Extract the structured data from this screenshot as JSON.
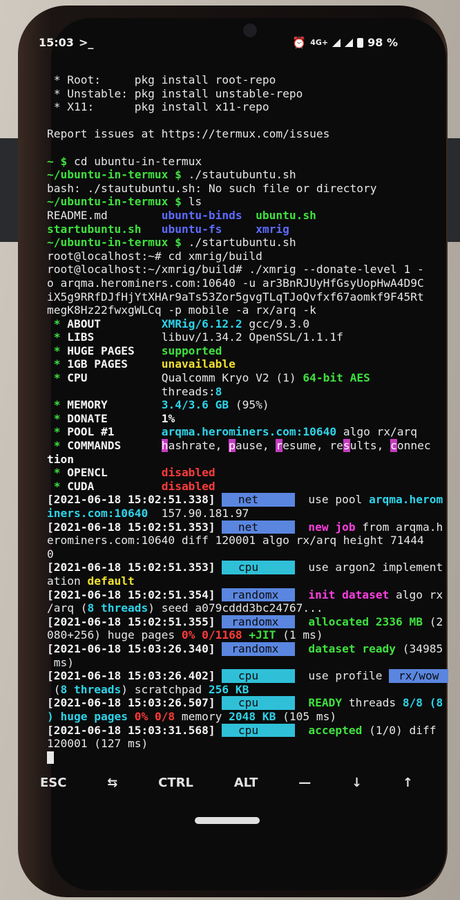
{
  "status_bar": {
    "time": "15:03",
    "prompt_icon": ">_",
    "network": "4G+",
    "battery": "98 %",
    "icons": [
      "alarm-icon",
      "signal-icon",
      "signal-icon",
      "battery-icon"
    ]
  },
  "terminal_lines": [
    [
      {
        "t": " * Root:     pkg install root-repo"
      }
    ],
    [
      {
        "t": " * Unstable: pkg install unstable-repo"
      }
    ],
    [
      {
        "t": " * X11:      pkg install x11-repo"
      }
    ],
    [
      {
        "t": ""
      }
    ],
    [
      {
        "t": "Report issues at https://termux.com/issues"
      }
    ],
    [
      {
        "t": ""
      }
    ],
    [
      {
        "t": "~ $ ",
        "c": "g"
      },
      {
        "t": "cd ubuntu-in-termux"
      }
    ],
    [
      {
        "t": "~/ubuntu-in-termux $ ",
        "c": "g"
      },
      {
        "t": "./stautubuntu.sh"
      }
    ],
    [
      {
        "t": "bash: ./stautubuntu.sh: No such file or directory"
      }
    ],
    [
      {
        "t": "~/ubuntu-in-termux $ ",
        "c": "g"
      },
      {
        "t": "ls"
      }
    ],
    [
      {
        "t": "README.md        "
      },
      {
        "t": "ubuntu-binds",
        "c": "b"
      },
      {
        "t": "  "
      },
      {
        "t": "ubuntu.sh",
        "c": "g"
      }
    ],
    [
      {
        "t": "startubuntu.sh",
        "c": "g"
      },
      {
        "t": "   "
      },
      {
        "t": "ubuntu-fs",
        "c": "b"
      },
      {
        "t": "     "
      },
      {
        "t": "xmrig",
        "c": "b"
      }
    ],
    [
      {
        "t": "~/ubuntu-in-termux $ ",
        "c": "g"
      },
      {
        "t": "./startubuntu.sh"
      }
    ],
    [
      {
        "t": "root@localhost:~# cd xmrig/build"
      }
    ],
    [
      {
        "t": "root@localhost:~/xmrig/build# ./xmrig --donate-level 1 -"
      }
    ],
    [
      {
        "t": "o arqma.herominers.com:10640 -u ar3BnRJUyHfGsyUopHwA4D9C"
      }
    ],
    [
      {
        "t": "iX5g9RRfDJfHjYtXHAr9aTs53Zor5gvgTLqTJoQvfxf67aomkf9F45Rt"
      }
    ],
    [
      {
        "t": "megK8Hz22fwxgWLCq -p mobile -a rx/arq -k"
      }
    ],
    [
      {
        "t": " * ",
        "c": "g"
      },
      {
        "t": "ABOUT         ",
        "c": "w"
      },
      {
        "t": "XMRig/6.12.2",
        "c": "c"
      },
      {
        "t": " gcc/9.3.0"
      }
    ],
    [
      {
        "t": " * ",
        "c": "g"
      },
      {
        "t": "LIBS          ",
        "c": "w"
      },
      {
        "t": "libuv/1.34.2 OpenSSL/1.1.1f"
      }
    ],
    [
      {
        "t": " * ",
        "c": "g"
      },
      {
        "t": "HUGE PAGES    ",
        "c": "w"
      },
      {
        "t": "supported",
        "c": "g"
      }
    ],
    [
      {
        "t": " * ",
        "c": "g"
      },
      {
        "t": "1GB PAGES     ",
        "c": "w"
      },
      {
        "t": "unavailable",
        "c": "y"
      }
    ],
    [
      {
        "t": " * ",
        "c": "g"
      },
      {
        "t": "CPU           ",
        "c": "w"
      },
      {
        "t": "Qualcomm Kryo V2 (1) "
      },
      {
        "t": "64-bit AES",
        "c": "g"
      }
    ],
    [
      {
        "t": "                 threads:"
      },
      {
        "t": "8",
        "c": "c"
      }
    ],
    [
      {
        "t": " * ",
        "c": "g"
      },
      {
        "t": "MEMORY        ",
        "c": "w"
      },
      {
        "t": "3.4/3.6 GB",
        "c": "c"
      },
      {
        "t": " (95%)"
      }
    ],
    [
      {
        "t": " * ",
        "c": "g"
      },
      {
        "t": "DONATE        ",
        "c": "w"
      },
      {
        "t": "1%",
        "c": "w"
      }
    ],
    [
      {
        "t": " * ",
        "c": "g"
      },
      {
        "t": "POOL #1       ",
        "c": "w"
      },
      {
        "t": "arqma.herominers.com:10640",
        "c": "c"
      },
      {
        "t": " algo rx/arq"
      }
    ],
    [
      {
        "t": " * ",
        "c": "g"
      },
      {
        "t": "COMMANDS      ",
        "c": "w"
      },
      {
        "t": "h",
        "c": "hl"
      },
      {
        "t": "ashrate, "
      },
      {
        "t": "p",
        "c": "hl"
      },
      {
        "t": "ause, "
      },
      {
        "t": "r",
        "c": "hl"
      },
      {
        "t": "esume, re"
      },
      {
        "t": "s",
        "c": "hl"
      },
      {
        "t": "ults, "
      },
      {
        "t": "c",
        "c": "hl"
      },
      {
        "t": "onnec"
      }
    ],
    [
      {
        "t": "tion",
        "c": "w"
      }
    ],
    [
      {
        "t": " * ",
        "c": "g"
      },
      {
        "t": "OPENCL        ",
        "c": "w"
      },
      {
        "t": "disabled",
        "c": "r"
      }
    ],
    [
      {
        "t": " * ",
        "c": "g"
      },
      {
        "t": "CUDA          ",
        "c": "w"
      },
      {
        "t": "disabled",
        "c": "r"
      }
    ],
    [
      {
        "t": "[2021-06-18 15:02:51.338] ",
        "c": "w"
      },
      {
        "t": "  net     ",
        "c": "tag net"
      },
      {
        "t": "  use pool "
      },
      {
        "t": "arqma.herom",
        "c": "c"
      }
    ],
    [
      {
        "t": "iners.com:10640",
        "c": "c"
      },
      {
        "t": "  157.90.181.97"
      }
    ],
    [
      {
        "t": "[2021-06-18 15:02:51.353] ",
        "c": "w"
      },
      {
        "t": "  net     ",
        "c": "tag net"
      },
      {
        "t": "  "
      },
      {
        "t": "new job",
        "c": "m"
      },
      {
        "t": " from arqma.h"
      }
    ],
    [
      {
        "t": "erominers.com:10640 diff 120001 algo rx/arq height 71444"
      }
    ],
    [
      {
        "t": "0"
      }
    ],
    [
      {
        "t": "[2021-06-18 15:02:51.353] ",
        "c": "w"
      },
      {
        "t": "  cpu     ",
        "c": "tag cpu"
      },
      {
        "t": "  use argon2 implement"
      }
    ],
    [
      {
        "t": "ation "
      },
      {
        "t": "default",
        "c": "y"
      }
    ],
    [
      {
        "t": "[2021-06-18 15:02:51.354] ",
        "c": "w"
      },
      {
        "t": " randomx  ",
        "c": "tag rx"
      },
      {
        "t": "  "
      },
      {
        "t": "init dataset",
        "c": "m"
      },
      {
        "t": " algo rx"
      }
    ],
    [
      {
        "t": "/arq ("
      },
      {
        "t": "8 threads",
        "c": "c"
      },
      {
        "t": ") seed a079cddd3bc24767..."
      }
    ],
    [
      {
        "t": "[2021-06-18 15:02:51.355] ",
        "c": "w"
      },
      {
        "t": " randomx  ",
        "c": "tag rx"
      },
      {
        "t": "  "
      },
      {
        "t": "allocated 2336 MB",
        "c": "g"
      },
      {
        "t": " (2"
      }
    ],
    [
      {
        "t": "080+256) huge pages "
      },
      {
        "t": "0% 0/1168",
        "c": "r"
      },
      {
        "t": " "
      },
      {
        "t": "+JIT",
        "c": "g"
      },
      {
        "t": " (1 ms)"
      }
    ],
    [
      {
        "t": "[2021-06-18 15:03:26.340] ",
        "c": "w"
      },
      {
        "t": " randomx  ",
        "c": "tag rx"
      },
      {
        "t": "  "
      },
      {
        "t": "dataset ready",
        "c": "g"
      },
      {
        "t": " (34985"
      }
    ],
    [
      {
        "t": " ms)"
      }
    ],
    [
      {
        "t": "[2021-06-18 15:03:26.402] ",
        "c": "w"
      },
      {
        "t": "  cpu     ",
        "c": "tag cpu"
      },
      {
        "t": "  use profile "
      },
      {
        "t": " rx/wow ",
        "c": "tag wow"
      }
    ],
    [
      {
        "t": " ("
      },
      {
        "t": "8 threads",
        "c": "c"
      },
      {
        "t": ") scratchpad "
      },
      {
        "t": "256 KB",
        "c": "c"
      }
    ],
    [
      {
        "t": "[2021-06-18 15:03:26.507] ",
        "c": "w"
      },
      {
        "t": "  cpu     ",
        "c": "tag cpu"
      },
      {
        "t": "  "
      },
      {
        "t": "READY",
        "c": "g"
      },
      {
        "t": " threads "
      },
      {
        "t": "8/8 (8",
        "c": "c"
      }
    ],
    [
      {
        "t": ") huge pages ",
        "c": "c"
      },
      {
        "t": "0% 0/8",
        "c": "r"
      },
      {
        "t": " memory "
      },
      {
        "t": "2048 KB",
        "c": "c"
      },
      {
        "t": " (105 ms)"
      }
    ],
    [
      {
        "t": "[2021-06-18 15:03:31.568] ",
        "c": "w"
      },
      {
        "t": "  cpu     ",
        "c": "tag cpu"
      },
      {
        "t": "  "
      },
      {
        "t": "accepted",
        "c": "g"
      },
      {
        "t": " (1/0) diff"
      }
    ],
    [
      {
        "t": "120001 (127 ms)"
      }
    ]
  ],
  "extra_keys": [
    {
      "label": "ESC",
      "name": "esc-key"
    },
    {
      "label": "⇆",
      "name": "tab-key"
    },
    {
      "label": "CTRL",
      "name": "ctrl-key"
    },
    {
      "label": "ALT",
      "name": "alt-key"
    },
    {
      "label": "—",
      "name": "dash-key"
    },
    {
      "label": "↓",
      "name": "down-arrow-key"
    },
    {
      "label": "↑",
      "name": "up-arrow-key"
    }
  ]
}
